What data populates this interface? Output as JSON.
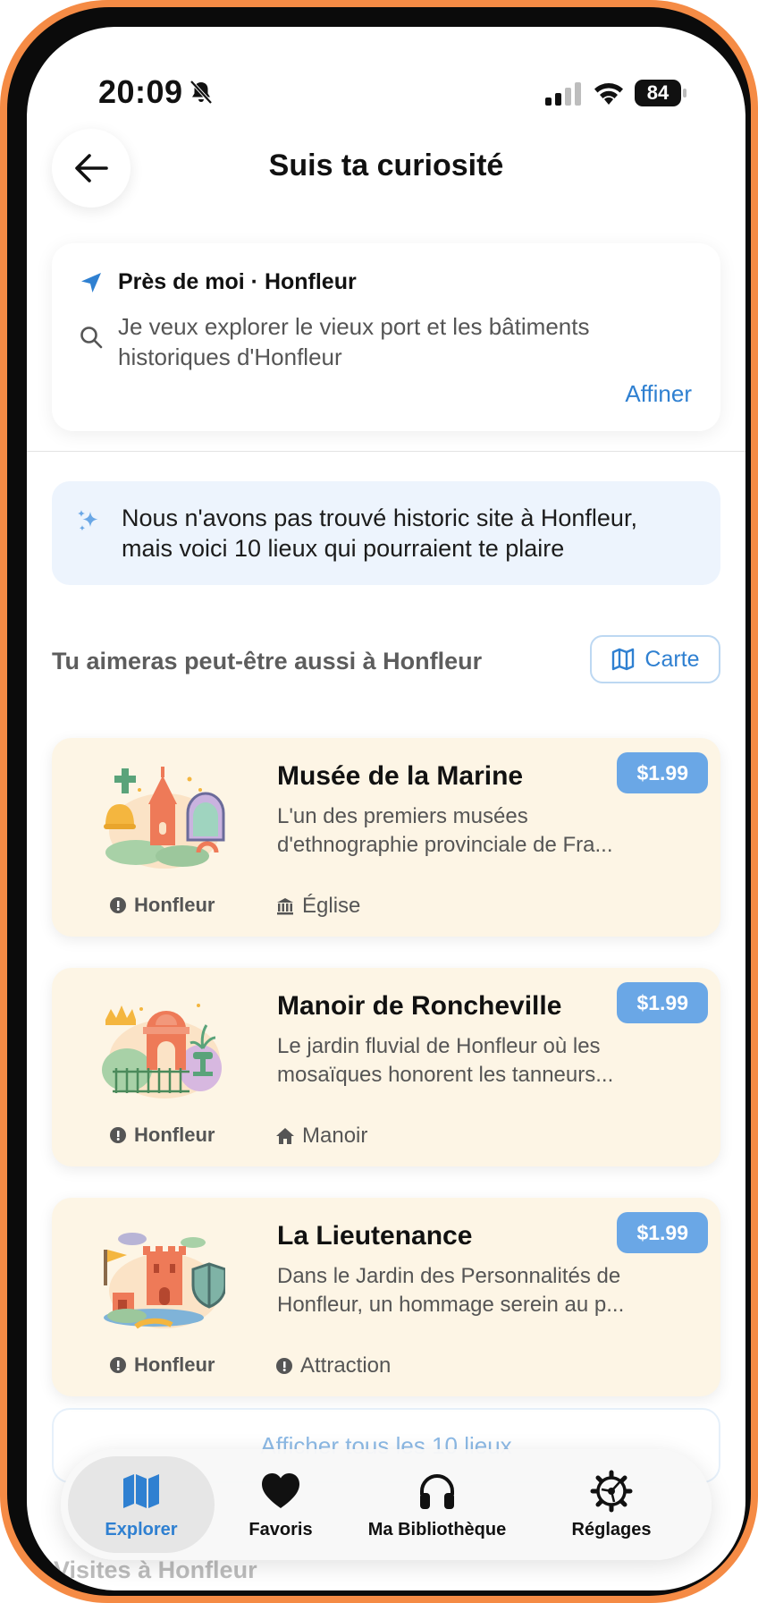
{
  "status_bar": {
    "time": "20:09",
    "battery": "84"
  },
  "header": {
    "title": "Suis ta curiosité"
  },
  "search": {
    "location": "Près de moi · Honfleur",
    "query_line1": "Je veux explorer le vieux port et les bâtiments",
    "query_line2": "historiques d'Honfleur",
    "refine_label": "Affiner"
  },
  "notice": {
    "line1": "Nous n'avons pas trouvé historic site à Honfleur,",
    "line2": "mais voici 10 lieux qui pourraient te plaire"
  },
  "section": {
    "title": "Tu aimeras peut-être aussi à Honfleur",
    "map_label": "Carte"
  },
  "places": [
    {
      "name": "Musée de la Marine",
      "desc_line1": "L'un des premiers musées",
      "desc_line2": "d'ethnographie provinciale de Fra...",
      "price": "$1.99",
      "city": "Honfleur",
      "category": "Église",
      "category_icon": "building-columns-icon"
    },
    {
      "name": "Manoir de Roncheville",
      "desc_line1": "Le jardin fluvial de Honfleur où les",
      "desc_line2": "mosaïques honorent les tanneurs...",
      "price": "$1.99",
      "city": "Honfleur",
      "category": "Manoir",
      "category_icon": "house-icon"
    },
    {
      "name": "La Lieutenance",
      "desc_line1": "Dans le Jardin des Personnalités de",
      "desc_line2": "Honfleur, un hommage serein au p...",
      "price": "$1.99",
      "city": "Honfleur",
      "category": "Attraction",
      "category_icon": "pin-icon"
    }
  ],
  "show_all_label": "Afficher tous les 10 lieux",
  "next_section_title": "Visites à Honfleur",
  "tabs": [
    {
      "label": "Explorer",
      "icon": "map-icon",
      "active": true
    },
    {
      "label": "Favoris",
      "icon": "heart-icon",
      "active": false
    },
    {
      "label": "Ma Bibliothèque",
      "icon": "headphones-icon",
      "active": false
    },
    {
      "label": "Réglages",
      "icon": "gear-icon",
      "active": false
    }
  ],
  "colors": {
    "frame": "#f58b45",
    "accent": "#2f80d1",
    "price_badge": "#6aa7e6",
    "card_bg": "#fdf5e5",
    "notice_bg": "#edf4fd"
  }
}
